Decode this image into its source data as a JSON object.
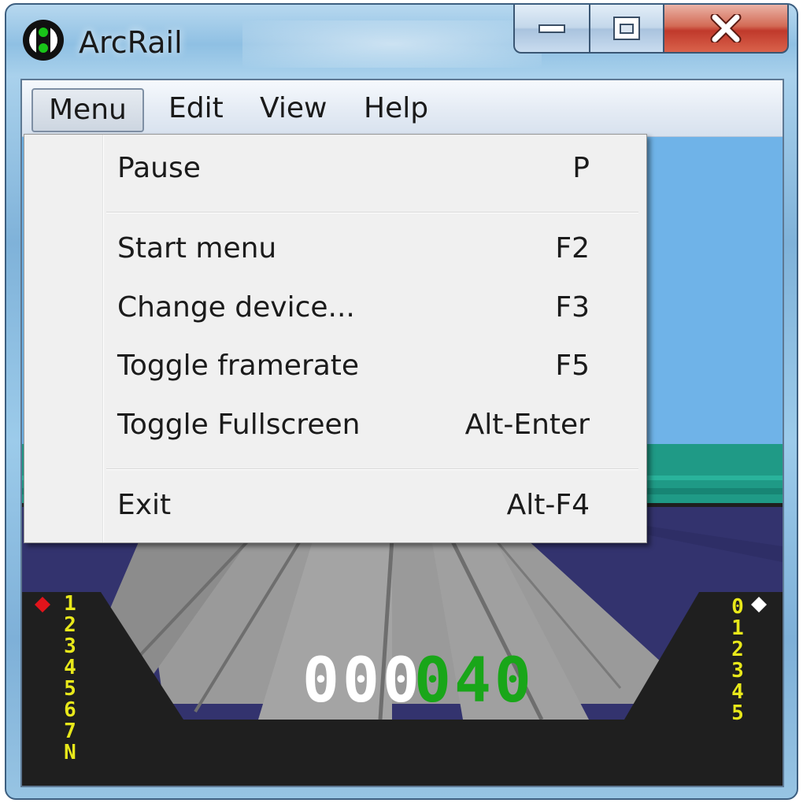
{
  "window": {
    "title": "ArcRail"
  },
  "menubar": {
    "items": [
      {
        "label": "Menu",
        "active": true
      },
      {
        "label": "Edit",
        "active": false
      },
      {
        "label": "View",
        "active": false
      },
      {
        "label": "Help",
        "active": false
      }
    ]
  },
  "dropdown": {
    "items": [
      {
        "label": "Pause",
        "shortcut": "P"
      },
      {
        "label": "Start menu",
        "shortcut": "F2"
      },
      {
        "label": "Change device...",
        "shortcut": "F3"
      },
      {
        "label": "Toggle framerate",
        "shortcut": "F5"
      },
      {
        "label": "Toggle Fullscreen",
        "shortcut": "Alt-Enter"
      },
      {
        "label": "Exit",
        "shortcut": "Alt-F4"
      }
    ]
  },
  "hud": {
    "left_counter": "000",
    "right_counter": "040",
    "left_gauge": [
      "1",
      "2",
      "3",
      "4",
      "5",
      "6",
      "7",
      "N"
    ],
    "right_gauge": [
      "0",
      "1",
      "2",
      "3",
      "4",
      "5"
    ]
  },
  "colors": {
    "sky": "#6fb3e8",
    "sea": "#1f9a86",
    "ground": "#33336e",
    "track": "#9a9a9a",
    "hud_panel": "#1f1f1f",
    "hud_yellow": "#e8e81a",
    "hud_green": "#19a619",
    "left_marker": "#e0141b",
    "right_marker": "#ffffff"
  }
}
